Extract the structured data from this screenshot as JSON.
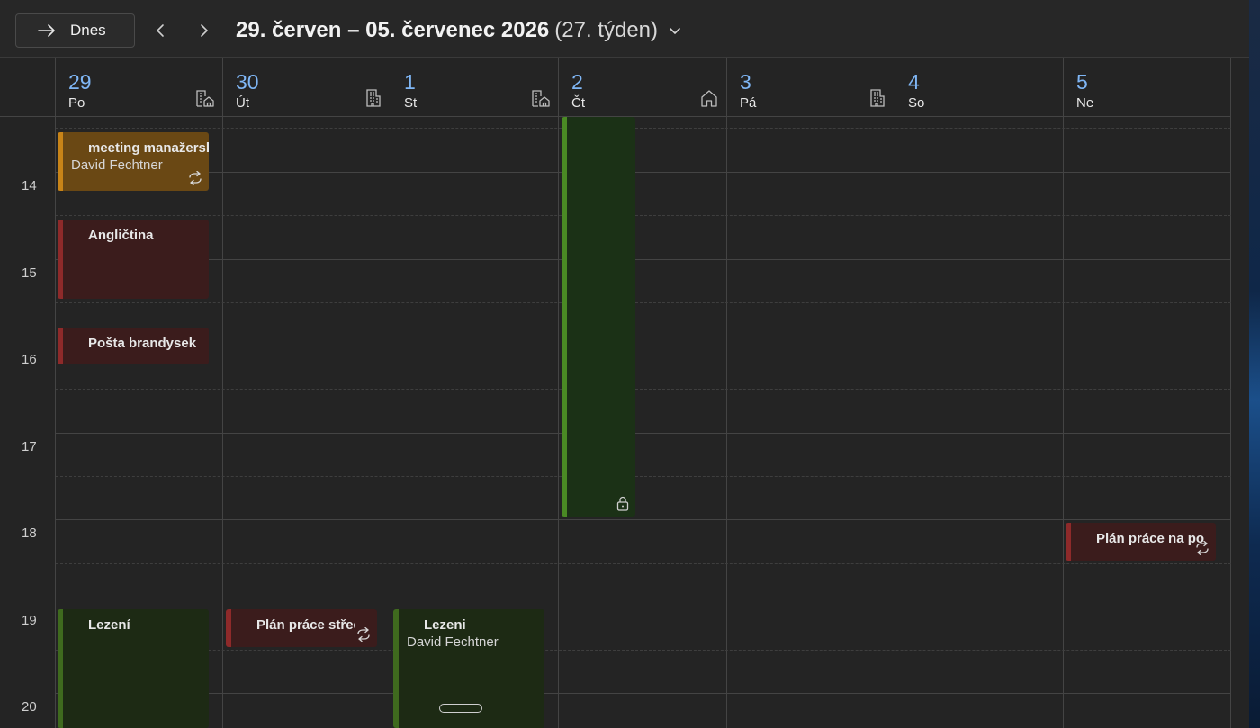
{
  "toolbar": {
    "today_label": "Dnes",
    "range_main": "29. červen – 05. červenec 2026",
    "range_week": "(27. týden)"
  },
  "days": [
    {
      "num": "29",
      "name": "Po",
      "icon": "building-home-icon"
    },
    {
      "num": "30",
      "name": "Út",
      "icon": "building-icon"
    },
    {
      "num": "1",
      "name": "St",
      "icon": "building-home-icon"
    },
    {
      "num": "2",
      "name": "Čt",
      "icon": "home-icon"
    },
    {
      "num": "3",
      "name": "Pá",
      "icon": "building-icon"
    },
    {
      "num": "4",
      "name": "So",
      "icon": ""
    },
    {
      "num": "5",
      "name": "Ne",
      "icon": ""
    }
  ],
  "hours": [
    "14",
    "15",
    "16",
    "17",
    "18",
    "19",
    "20"
  ],
  "events": {
    "meeting": {
      "title": "meeting manažersk",
      "subtitle": "David Fechtner",
      "color": "#c88418",
      "recurring": true
    },
    "anglictina": {
      "title": "Angličtina",
      "color": "#8e2a2a"
    },
    "posta": {
      "title": "Pošta brandysek",
      "color": "#8e2a2a"
    },
    "thursday_block": {
      "title": "",
      "color": "#4a8a24",
      "locked": true
    },
    "plan_po": {
      "title": "Plán práce na po",
      "color": "#8e2a2a",
      "recurring": true
    },
    "lezeni_po": {
      "title": "Lezení",
      "color": "#3f6a1e"
    },
    "plan_streda": {
      "title": "Plán práce středa",
      "color": "#8e2a2a",
      "recurring": true
    },
    "lezeni_st": {
      "title": "Lezeni",
      "subtitle": "David Fechtner",
      "color": "#3f6a1e"
    }
  }
}
